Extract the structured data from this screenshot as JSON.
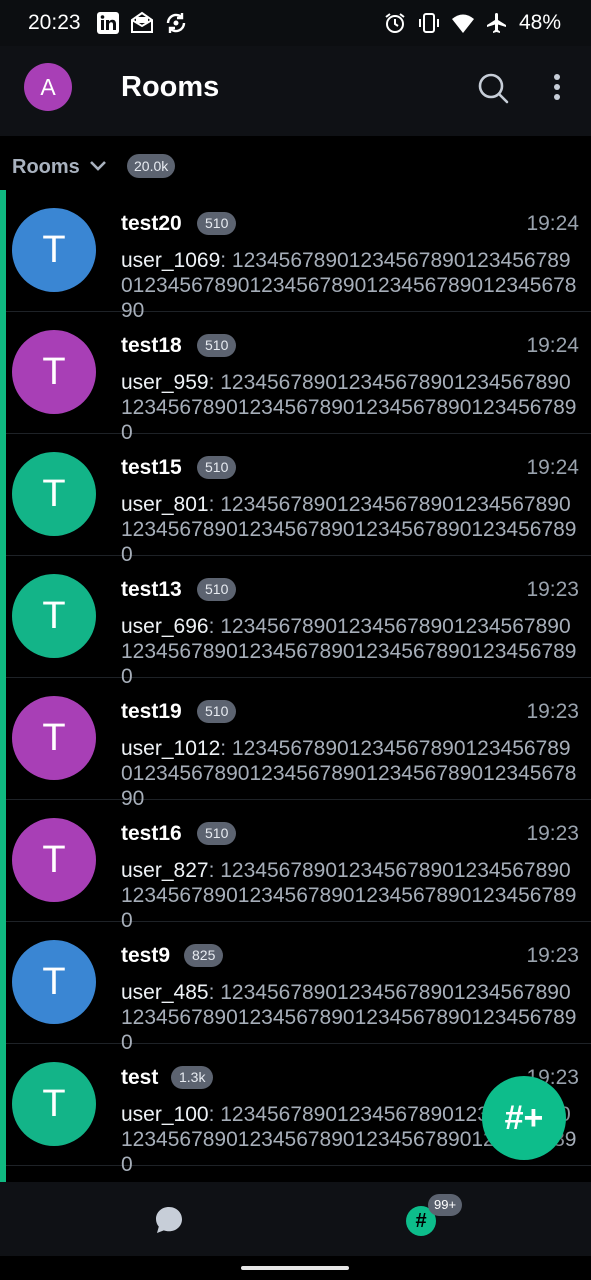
{
  "status_bar": {
    "time": "20:23",
    "battery": "48%",
    "icons_left": [
      "linkedin-icon",
      "mail-icon",
      "sync-icon"
    ],
    "icons_right": [
      "alarm-icon",
      "vibrate-icon",
      "wifi-icon",
      "airplane-icon"
    ]
  },
  "top_bar": {
    "avatar_initial": "A",
    "title": "Rooms",
    "avatar_color": "#a83fb6"
  },
  "section": {
    "label": "Rooms",
    "count": "20.0k"
  },
  "rooms": [
    {
      "initial": "T",
      "name": "test20",
      "badge": "510",
      "time": "19:24",
      "sender": "user_1069",
      "message": ": 1234567890123456789012345678901234567890123456789012345678901234567890",
      "avatar_color": "#3a86d3"
    },
    {
      "initial": "T",
      "name": "test18",
      "badge": "510",
      "time": "19:24",
      "sender": "user_959",
      "message": ": 1234567890123456789012345678901234567890123456789012345678901234567890",
      "avatar_color": "#a83fb6"
    },
    {
      "initial": "T",
      "name": "test15",
      "badge": "510",
      "time": "19:24",
      "sender": "user_801",
      "message": ": 1234567890123456789012345678901234567890123456789012345678901234567890",
      "avatar_color": "#13b488"
    },
    {
      "initial": "T",
      "name": "test13",
      "badge": "510",
      "time": "19:23",
      "sender": "user_696",
      "message": ": 1234567890123456789012345678901234567890123456789012345678901234567890",
      "avatar_color": "#13b488"
    },
    {
      "initial": "T",
      "name": "test19",
      "badge": "510",
      "time": "19:23",
      "sender": "user_1012",
      "message": ": 1234567890123456789012345678901234567890123456789012345678901234567890",
      "avatar_color": "#a83fb6"
    },
    {
      "initial": "T",
      "name": "test16",
      "badge": "510",
      "time": "19:23",
      "sender": "user_827",
      "message": ": 1234567890123456789012345678901234567890123456789012345678901234567890",
      "avatar_color": "#a83fb6"
    },
    {
      "initial": "T",
      "name": "test9",
      "badge": "825",
      "time": "19:23",
      "sender": "user_485",
      "message": ": 1234567890123456789012345678901234567890123456789012345678901234567890",
      "avatar_color": "#3a86d3"
    },
    {
      "initial": "T",
      "name": "test",
      "badge": "1.3k",
      "time": "19:23",
      "sender": "user_100",
      "message": ": 1234567890123456789012345678901234567890123456789012345678901234567890",
      "avatar_color": "#13b488"
    }
  ],
  "fab": {
    "label": "#+"
  },
  "bottom_nav": {
    "rooms_icon_label": "#",
    "rooms_badge": "99+"
  },
  "colors": {
    "accent": "#0dbd8b",
    "unread_bar": "#10b981",
    "badge_bg": "#5c6370"
  }
}
